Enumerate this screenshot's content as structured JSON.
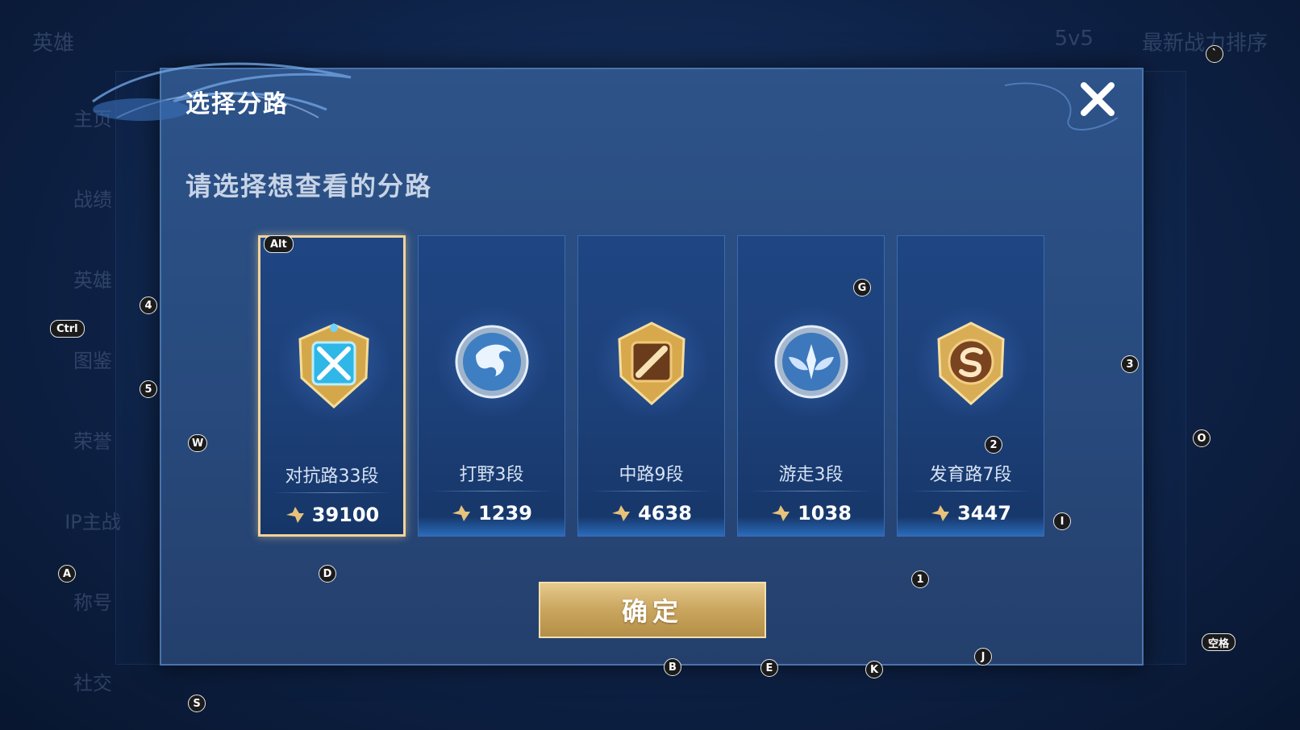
{
  "dialog": {
    "title": "选择分路",
    "subtitle": "请选择想查看的分路",
    "confirm_label": "确定",
    "close_icon": "close-icon"
  },
  "lanes": [
    {
      "name": "对抗路33段",
      "score": "39100",
      "icon": "clash-lane-emblem-icon",
      "selected": true
    },
    {
      "name": "打野3段",
      "score": "1239",
      "icon": "jungle-emblem-icon",
      "selected": false
    },
    {
      "name": "中路9段",
      "score": "4638",
      "icon": "mid-lane-emblem-icon",
      "selected": false
    },
    {
      "name": "游走3段",
      "score": "1038",
      "icon": "roam-emblem-icon",
      "selected": false
    },
    {
      "name": "发育路7段",
      "score": "3447",
      "icon": "farm-lane-emblem-icon",
      "selected": false
    }
  ],
  "background": {
    "top": [
      "英雄",
      "5v5",
      "最新战力排序"
    ],
    "side": [
      "主页",
      "战绩",
      "英雄",
      "图鉴",
      "荣誉",
      "IP主战",
      "称号",
      "社交"
    ]
  },
  "key_hints": [
    "Alt",
    "Ctrl",
    "4",
    "5",
    "W",
    "A",
    "D",
    "S",
    "G",
    "3",
    "2",
    "I",
    "O",
    "1",
    "J",
    "K",
    "E",
    "B",
    "`",
    "空格"
  ],
  "colors": {
    "accent_gold": "#e6c98c",
    "panel_blue": "#2d5389",
    "selected_border": "#f2d39a"
  }
}
